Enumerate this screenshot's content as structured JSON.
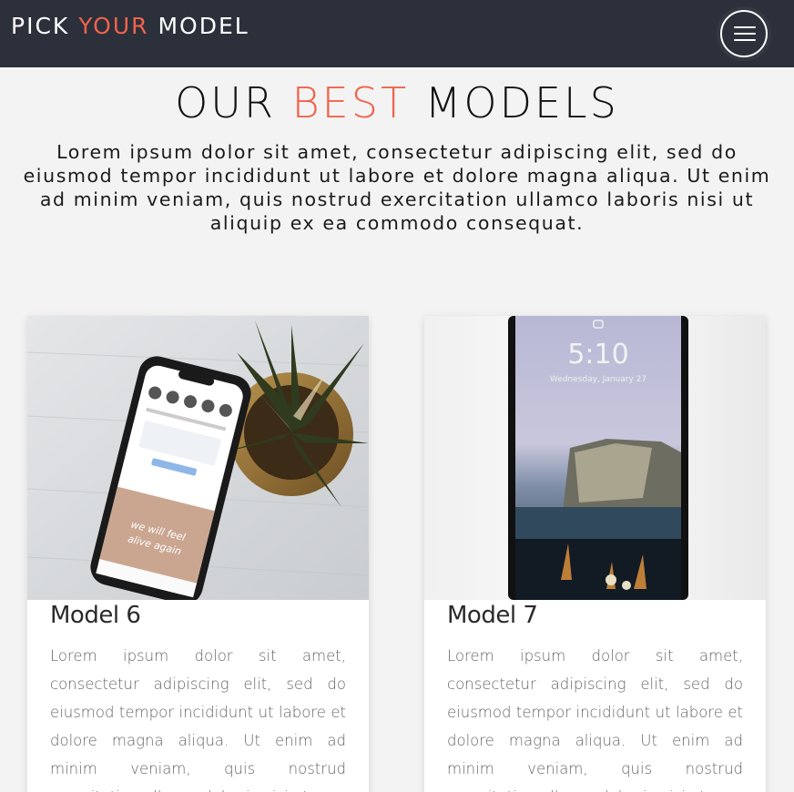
{
  "nav": {
    "brand_prefix": "PICK",
    "brand_accent": "YOUR",
    "brand_suffix": "MODEL",
    "menu_icon": "hamburger-icon"
  },
  "hero": {
    "title_prefix": "OUR",
    "title_accent": "BEST",
    "title_suffix": "MODELS",
    "intro": "Lorem ipsum dolor sit amet, consectetur adipiscing elit, sed do eiusmod tempor incididunt ut labore et dolore magna aliqua. Ut enim ad minim veniam, quis nostrud exercitation ullamco laboris nisi ut aliquip ex ea commodo consequat."
  },
  "cards": [
    {
      "title": "Model 6",
      "text": "Lorem ipsum dolor sit amet, consectetur adipiscing elit, sed do eiusmod tempor incididunt ut labore et dolore magna aliqua. Ut enim ad minim veniam, quis nostrud exercitation ullamco laboris nisi ut",
      "screen_text": "we will feel alive again"
    },
    {
      "title": "Model 7",
      "text": "Lorem ipsum dolor sit amet, consectetur adipiscing elit, sed do eiusmod tempor incididunt ut labore et dolore magna aliqua. Ut enim ad minim veniam, quis nostrud exercitation ullamco laboris nisi ut",
      "lock_time": "5:10",
      "lock_date": "Wednesday, January 27"
    }
  ],
  "colors": {
    "nav_bg": "#2b303b",
    "accent": "#f0634b",
    "page_bg": "#f3f3f3"
  }
}
